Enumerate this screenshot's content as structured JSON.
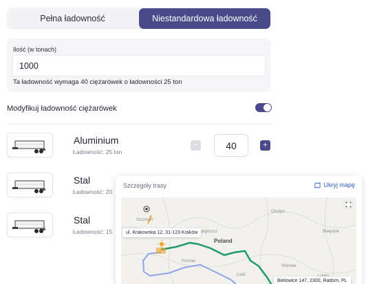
{
  "tabs": [
    {
      "label": "Pełna ładowność",
      "active": false
    },
    {
      "label": "Niestandardowa ładowność",
      "active": true
    }
  ],
  "quantity": {
    "label": "Ilość (w tonach)",
    "value": "1000",
    "note": "Ta ładowność wymaga 40 ciężarówek o ładowności 25 ton"
  },
  "modify": {
    "label": "Modyfikuj ładowność ciężarówek",
    "enabled": true
  },
  "trucks": [
    {
      "name": "Aluminium",
      "capacity": "Ładowność: 25 ton",
      "count": "40"
    },
    {
      "name": "Stal",
      "capacity": "Ładowność: 20"
    },
    {
      "name": "Stal",
      "capacity": "Ładowność: 15"
    }
  ],
  "route": {
    "title": "Szczegóły trasy",
    "hide_label": "Ukryj mapę",
    "origin_address": "ul. Krakowska 12, 31-123 Kraków",
    "destination_address": "Bielowice 147, 2300, Radom, PL",
    "map_labels": {
      "szczecin": "Szczecin",
      "poland": "Poland",
      "poznan": "Poznan",
      "bialystok": "Białystok",
      "warsaw": "Warsaw",
      "bydgoszcz": "Bydgoszcz",
      "lodz": "Łódź",
      "olsztyn": "Olsztyn",
      "lublin": "Lublin"
    }
  },
  "colors": {
    "accent": "#4a4a8a",
    "route_green": "#1e9a6a",
    "route_blue": "#8fa5e6",
    "route_orange": "#f0a020",
    "link": "#2c5db8"
  },
  "icons": {
    "minus": "minus-icon",
    "plus": "plus-icon",
    "hide_map": "map-icon",
    "fullscreen": "fullscreen-icon",
    "truck": "truck-trailer-icon"
  }
}
